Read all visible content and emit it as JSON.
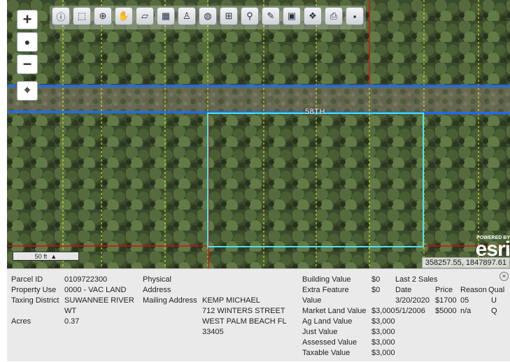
{
  "map": {
    "street_label": "58TH",
    "scale_label": "50 ft",
    "attribution_powered": "POWERED BY",
    "attribution_logo": "esri",
    "coordinates": "358257.55, 1847897.61",
    "zoom_in": "+",
    "zoom_out": "−"
  },
  "colors": {
    "road": "#1a6cff",
    "parcel_highlight": "#4fe3f0",
    "parcel_line": "#d41010",
    "grid_line": "#e8f020"
  },
  "toolbar": {
    "icons": [
      "info-icon",
      "select-icon",
      "zoom-in-tool-icon",
      "pan-icon",
      "eraser-icon",
      "select-area-icon",
      "street-view-icon",
      "globe-icon",
      "measure-icon",
      "search-icon",
      "draw-icon",
      "print-map-icon",
      "layers-icon",
      "print-icon",
      "save-icon"
    ]
  },
  "panel": {
    "parcel_id_label": "Parcel ID",
    "parcel_id": "0109722300",
    "property_use_label": "Property Use",
    "property_use": "0000 - VAC LAND",
    "taxing_district_label": "Taxing District",
    "taxing_district_1": "SUWANNEE RIVER",
    "taxing_district_2": "WT",
    "acres_label": "Acres",
    "acres": "0.37",
    "physical_label_1": "Physical",
    "physical_label_2": "Address",
    "mailing_label": "Mailing Address",
    "owner_name": "KEMP MICHAEL",
    "owner_street": "712 WINTERS STREET",
    "owner_city": "WEST PALM BEACH FL",
    "owner_zip": "33405",
    "building_value_label": "Building Value",
    "building_value": "$0",
    "extra_feature_label_1": "Extra Feature",
    "extra_feature_label_2": "Value",
    "extra_feature_value": "$0",
    "market_land_label": "Market Land Value",
    "market_land_value": "$3,000",
    "ag_land_label": "Ag Land Value",
    "ag_land_value": "$3,000",
    "just_label": "Just Value",
    "just_value": "$3,000",
    "assessed_label": "Assessed Value",
    "assessed_value": "$3,000",
    "taxable_label": "Taxable Value",
    "taxable_value": "$3,000",
    "sales_title": "Last 2 Sales",
    "sales_headers": [
      "Date",
      "Price",
      "Reason",
      "Qual"
    ],
    "sales": [
      [
        "3/20/2020",
        "$1700",
        "05",
        "U"
      ],
      [
        "5/1/2006",
        "$5000",
        "n/a",
        "Q"
      ]
    ]
  }
}
